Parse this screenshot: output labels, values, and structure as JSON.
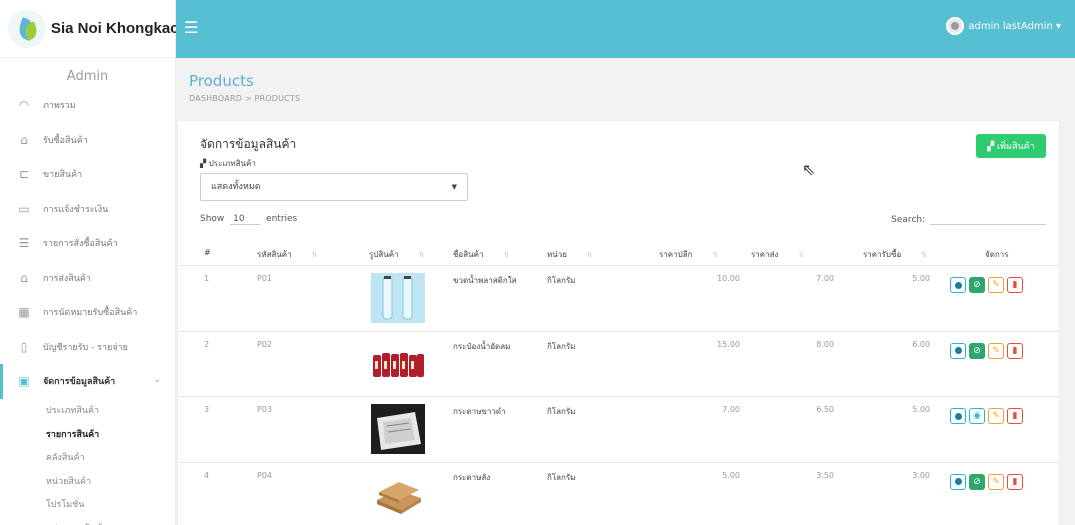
{
  "app": {
    "title": "Sia Noi Khongkao"
  },
  "header": {
    "menu_icon": "☰",
    "user": "admin lastAdmin ▾"
  },
  "sidebar": {
    "heading": "Admin",
    "items": [
      {
        "icon": "◠",
        "label": "ภาพรวม"
      },
      {
        "icon": "⌂",
        "label": "รับซื้อสินค้า"
      },
      {
        "icon": "⊏",
        "label": "ขายสินค้า"
      },
      {
        "icon": "▭",
        "label": "การแจ้งชำระเงิน"
      },
      {
        "icon": "☰",
        "label": "รายการสั่งซื้อสินค้า"
      },
      {
        "icon": "⌂",
        "label": "การส่งสินค้า"
      },
      {
        "icon": "▦",
        "label": "การนัดหมายรับซื้อสินค้า"
      },
      {
        "icon": "▯",
        "label": "บัญชีรายรับ - รายจ่าย"
      },
      {
        "icon": "▣",
        "label": "จัดการข้อมูลสินค้า",
        "chev": "⌄"
      }
    ],
    "sub": [
      "ประเภทสินค้า",
      "รายการสินค้า",
      "คลังสินค้า",
      "หน่วยสินค้า",
      "โปรโมชั่น",
      "แปรสภาพสินค้า"
    ]
  },
  "page": {
    "title": "Products",
    "breadcrumb": "DASHBOARD  >  PRODUCTS"
  },
  "card": {
    "title": "จัดการข้อมูลสินค้า",
    "add_button": "▞ เพิ่มสินค้า",
    "category_label": "▞ ประเภทสินค้า",
    "category_select": "แสดงทั้งหมด",
    "select_caret": "▼",
    "show": "Show",
    "entries": "entries",
    "page_size": "10",
    "search_label": "Search:"
  },
  "table": {
    "headers": [
      "#",
      "รหัสสินค้า",
      "รูปสินค้า",
      "ชื่อสินค้า",
      "หน่วย",
      "ราคาปลีก",
      "ราคาส่ง",
      "ราคารับซื้อ",
      "จัดการ"
    ],
    "sort_icon": "⇅",
    "rows": [
      {
        "n": "1",
        "code": "P01",
        "name": "ขวดน้ำพลาสติกใส",
        "unit": "กิโลกรัม",
        "retail": "10.00",
        "wholesale": "7.00",
        "buy": "5.00",
        "eye_outline": false,
        "image": "bottles"
      },
      {
        "n": "2",
        "code": "P02",
        "name": "กระป๋องน้ำอัดลม",
        "unit": "กิโลกรัม",
        "retail": "15.00",
        "wholesale": "8.00",
        "buy": "6.00",
        "eye_outline": false,
        "image": "cans"
      },
      {
        "n": "3",
        "code": "P03",
        "name": "กระดาษขาวดำ",
        "unit": "กิโลกรัม",
        "retail": "7.00",
        "wholesale": "6.50",
        "buy": "5.00",
        "eye_outline": true,
        "image": "paper"
      },
      {
        "n": "4",
        "code": "P04",
        "name": "กระดาษลัง",
        "unit": "กิโลกรัม",
        "retail": "5.00",
        "wholesale": "3.50",
        "buy": "3.00",
        "eye_outline": false,
        "image": "cardboard"
      }
    ]
  },
  "colors": {
    "accent": "#56c0d2",
    "add": "#2ecc71",
    "title": "#5aaed3"
  }
}
